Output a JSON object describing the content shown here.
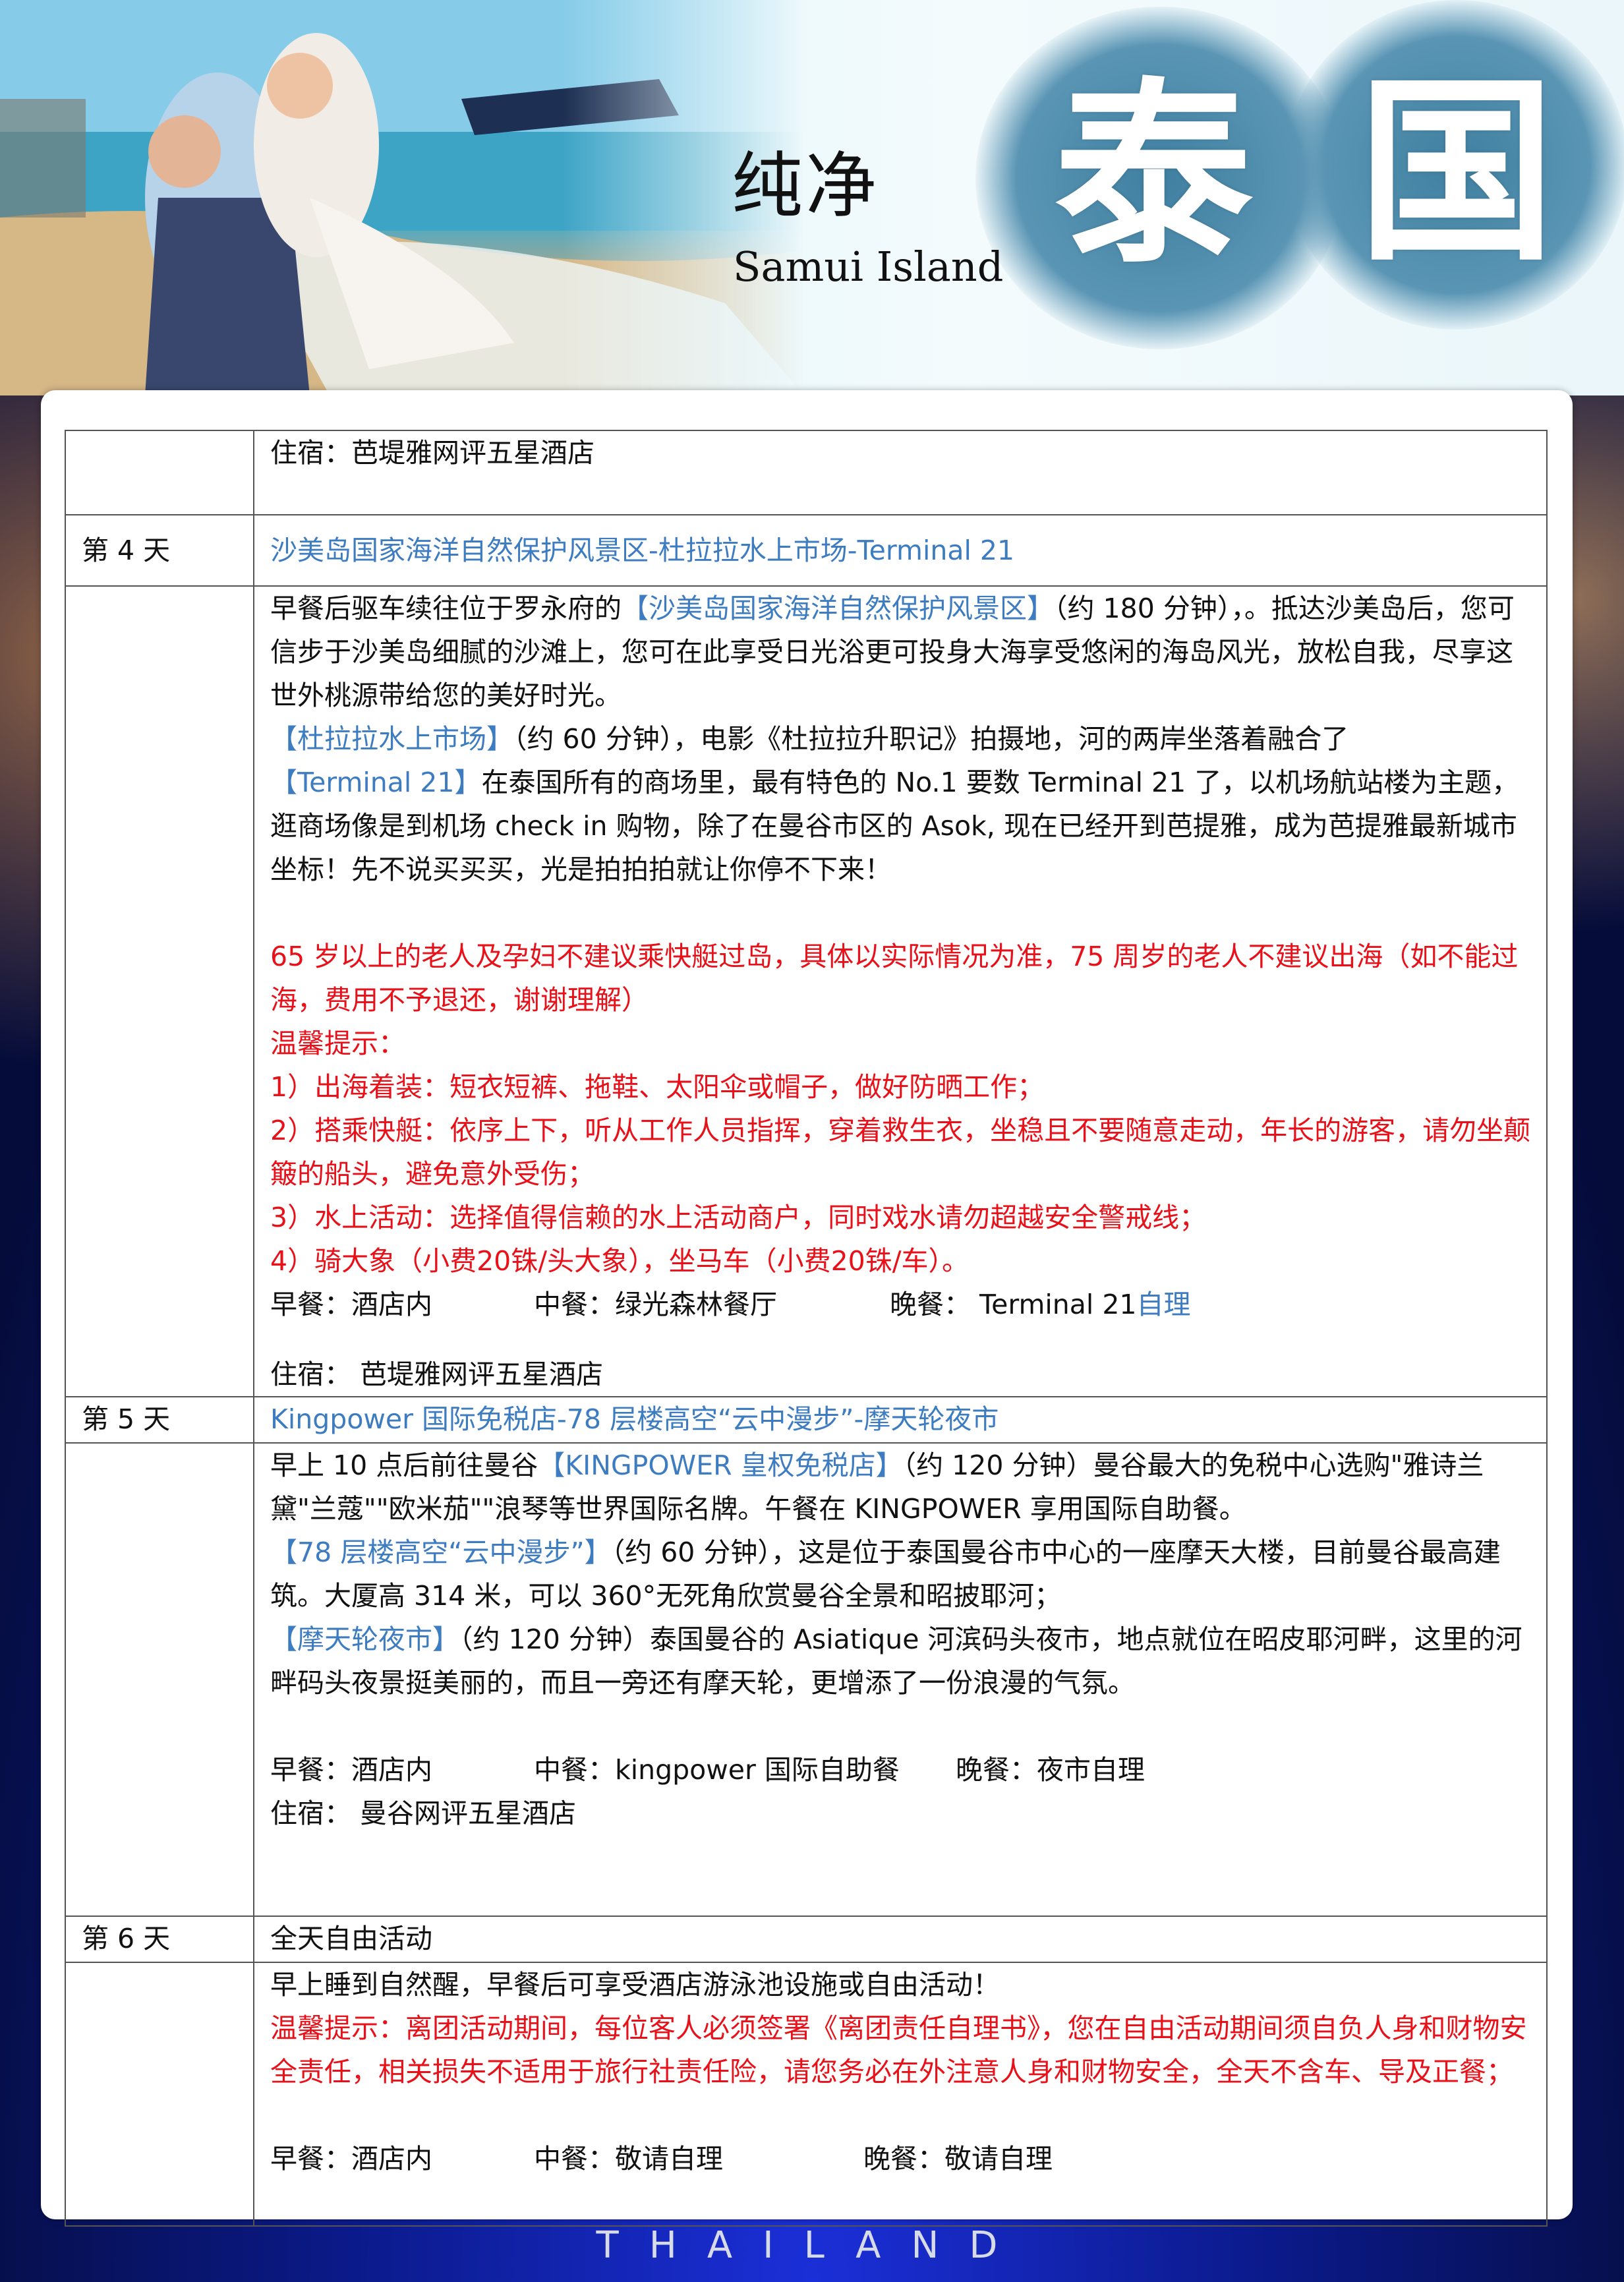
{
  "header": {
    "title_cn": "纯净",
    "title_en": "Samui Island",
    "big_char_1": "泰",
    "big_char_2": "国"
  },
  "day3_tail": {
    "hotel": "住宿：芭堤雅网评五星酒店"
  },
  "day4": {
    "label": "第 4 天",
    "route": "沙美岛国家海洋自然保护风景区-杜拉拉水上市场-Terminal 21",
    "p1_a": "早餐后驱车续往位于罗永府的",
    "p1_b": "【沙美岛国家海洋自然保护风景区】",
    "p1_c": "（约 180 分钟），。抵达沙美岛后，您可信步于沙美岛细腻的沙滩上，您可在此享受日光浴更可投身大海享受悠闲的海岛风光，放松自我，尽享这世外桃源带给您的美好时光。",
    "p2_a": "【杜拉拉水上市场】",
    "p2_b": "（约 60 分钟），电影《杜拉拉升职记》拍摄地，河的两岸坐落着融合了",
    "p3_a": "【Terminal 21】",
    "p3_b": "在泰国所有的商场里，最有特色的 No.1 要数 Terminal 21 了，以机场航站楼为主题，逛商场像是到机场 check in 购物，除了在曼谷市区的 Asok, 现在已经开到芭提雅，成为芭提雅最新城市坐标！先不说买买买，光是拍拍拍就让你停不下来！",
    "warning": "65 岁以上的老人及孕妇不建议乘快艇过岛，具体以实际情况为准，75 周岁的老人不建议出海（如不能过海，费用不予退还，谢谢理解）",
    "tips_title": "温馨提示：",
    "tips": [
      "1）出海着装：短衣短裤、拖鞋、太阳伞或帽子，做好防晒工作；",
      "2）搭乘快艇：依序上下，听从工作人员指挥，穿着救生衣，坐稳且不要随意走动，年长的游客，请勿坐颠簸的船头，避免意外受伤；",
      "3）水上活动：选择值得信赖的水上活动商户，同时戏水请勿超越安全警戒线；",
      "4）骑大象（小费20铢/头大象），坐马车（小费20铢/车）。"
    ],
    "breakfast": "早餐：酒店内",
    "lunch": "中餐：绿光森林餐厅",
    "dinner_a": "晚餐： Terminal 21",
    "dinner_b": "自理",
    "hotel": "住宿： 芭堤雅网评五星酒店"
  },
  "day5": {
    "label": "第 5 天",
    "route": "Kingpower 国际免税店-78 层楼高空“云中漫步”-摩天轮夜市",
    "p1_a": "早上 10 点后前往曼谷",
    "p1_b": "【KINGPOWER 皇权免税店】",
    "p1_c": "（约 120 分钟）曼谷最大的免税中心选购\"雅诗兰黛\"兰蔻\"\"欧米茄\"\"浪琴等世界国际名牌。午餐在 KINGPOWER 享用国际自助餐。",
    "p2_a": "【78 层楼高空“云中漫步”】",
    "p2_b": "（约 60 分钟），这是位于泰国曼谷市中心的一座摩天大楼，目前曼谷最高建筑。大厦高 314 米，可以 360°无死角欣赏曼谷全景和昭披耶河；",
    "p3_a": "【摩天轮夜市】",
    "p3_b": "（约 120 分钟）泰国曼谷的 Asiatique 河滨码头夜市，地点就位在昭皮耶河畔，这里的河畔码头夜景挺美丽的，而且一旁还有摩天轮，更增添了一份浪漫的气氛。",
    "breakfast": "早餐：酒店内",
    "lunch": "中餐：kingpower 国际自助餐",
    "dinner": "晚餐：夜市自理",
    "hotel": "住宿： 曼谷网评五星酒店"
  },
  "day6": {
    "label": "第 6 天",
    "route": "全天自由活动",
    "p1": "早上睡到自然醒，早餐后可享受酒店游泳池设施或自由活动！",
    "tip": "温馨提示：离团活动期间，每位客人必须签署《离团责任自理书》，您在自由活动期间须自负人身和财物安全责任，相关损失不适用于旅行社责任险，请您务必在外注意人身和财物安全，全天不含车、导及正餐；",
    "breakfast": "早餐：酒店内",
    "lunch": "中餐：敬请自理",
    "dinner": "晚餐：敬请自理"
  },
  "footer": "THAILAND",
  "colors": {
    "link_blue": "#3d7cc0",
    "warning_red": "#e8111a",
    "brush_blue": "#4a86a8"
  }
}
